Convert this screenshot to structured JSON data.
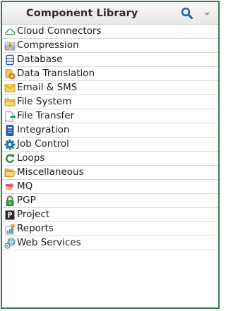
{
  "panel": {
    "title": "Component Library",
    "border_color": "#2f7d4c",
    "header_icons": [
      "search-icon",
      "chevron-down-icon"
    ]
  },
  "items": [
    {
      "label": "Cloud Connectors",
      "icon": "cloud-icon"
    },
    {
      "label": "Compression",
      "icon": "compression-icon"
    },
    {
      "label": "Database",
      "icon": "database-icon"
    },
    {
      "label": "Data Translation",
      "icon": "data-translation-icon"
    },
    {
      "label": "Email & SMS",
      "icon": "email-icon"
    },
    {
      "label": "File System",
      "icon": "folder-icon"
    },
    {
      "label": "File Transfer",
      "icon": "file-transfer-icon"
    },
    {
      "label": "Integration",
      "icon": "integration-icon"
    },
    {
      "label": "Job Control",
      "icon": "gear-icon"
    },
    {
      "label": "Loops",
      "icon": "loop-icon"
    },
    {
      "label": "Miscellaneous",
      "icon": "open-folder-icon"
    },
    {
      "label": "MQ",
      "icon": "mq-icon"
    },
    {
      "label": "PGP",
      "icon": "lock-icon"
    },
    {
      "label": "Project",
      "icon": "project-icon"
    },
    {
      "label": "Reports",
      "icon": "report-icon"
    },
    {
      "label": "Web Services",
      "icon": "web-services-icon"
    }
  ]
}
